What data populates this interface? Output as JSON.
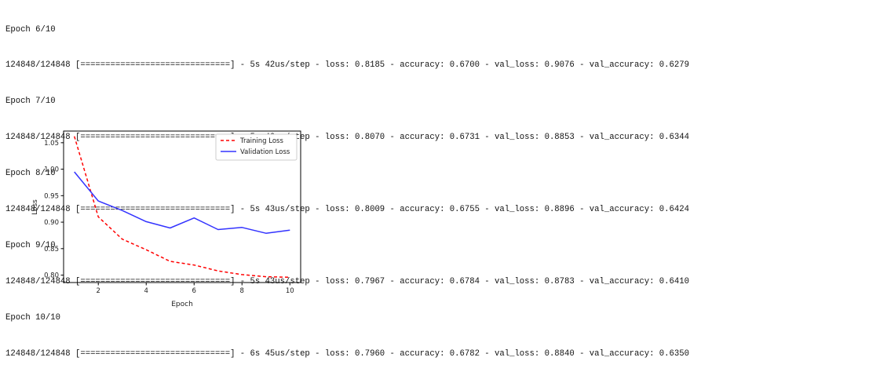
{
  "log": {
    "lines": [
      "Epoch 6/10",
      "124848/124848 [==============================] - 5s 42us/step - loss: 0.8185 - accuracy: 0.6700 - val_loss: 0.9076 - val_accuracy: 0.6279",
      "Epoch 7/10",
      "124848/124848 [==============================] - 5s 43us/step - loss: 0.8070 - accuracy: 0.6731 - val_loss: 0.8853 - val_accuracy: 0.6344",
      "Epoch 8/10",
      "124848/124848 [==============================] - 5s 43us/step - loss: 0.8009 - accuracy: 0.6755 - val_loss: 0.8896 - val_accuracy: 0.6424",
      "Epoch 9/10",
      "124848/124848 [==============================] - 5s 43us/step - loss: 0.7967 - accuracy: 0.6784 - val_loss: 0.8783 - val_accuracy: 0.6410",
      "Epoch 10/10",
      "124848/124848 [==============================] - 6s 45us/step - loss: 0.7960 - accuracy: 0.6782 - val_loss: 0.8840 - val_accuracy: 0.6350"
    ]
  },
  "chart_data": {
    "type": "line",
    "title": "",
    "xlabel": "Epoch",
    "ylabel": "Loss",
    "x": [
      1,
      2,
      3,
      4,
      5,
      6,
      7,
      8,
      9,
      10
    ],
    "xlim": [
      0.55,
      10.45
    ],
    "ylim": [
      0.786,
      1.072
    ],
    "xticks": [
      2,
      4,
      6,
      8,
      10
    ],
    "yticks": [
      0.8,
      0.85,
      0.9,
      0.95,
      1.0,
      1.05
    ],
    "ytick_labels": [
      "0.80",
      "0.85",
      "0.90",
      "0.95",
      "1.00",
      "1.05"
    ],
    "grid": false,
    "legend_position": "top-right",
    "series": [
      {
        "name": "Training Loss",
        "color": "#ff0000",
        "style": "dashed",
        "values": [
          1.062,
          0.91,
          0.868,
          0.848,
          0.826,
          0.819,
          0.808,
          0.801,
          0.797,
          0.796
        ]
      },
      {
        "name": "Validation Loss",
        "color": "#3333ff",
        "style": "solid",
        "values": [
          0.995,
          0.94,
          0.922,
          0.901,
          0.889,
          0.908,
          0.886,
          0.89,
          0.879,
          0.885
        ]
      }
    ]
  }
}
